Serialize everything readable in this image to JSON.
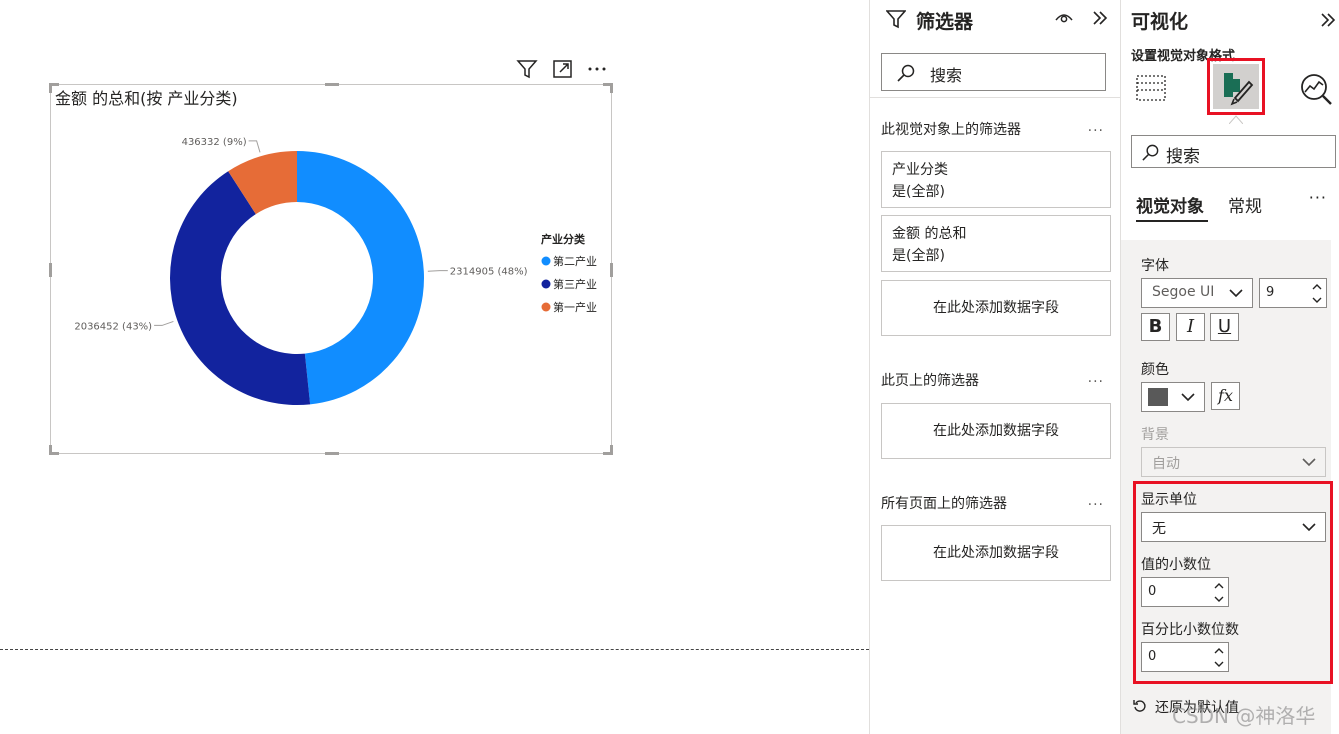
{
  "visual": {
    "title": "金额 的总和(按 产业分类)"
  },
  "chart_data": {
    "type": "pie",
    "subtype": "donut",
    "title": "金额 的总和(按 产业分类)",
    "legend_title": "产业分类",
    "legend_position": "right",
    "slices": [
      {
        "name": "第二产业",
        "value": 2314905,
        "percent": 48,
        "label": "2314905 (48%)",
        "color": "#118dff"
      },
      {
        "name": "第三产业",
        "value": 2036452,
        "percent": 43,
        "label": "2036452 (43%)",
        "color": "#12239e"
      },
      {
        "name": "第一产业",
        "value": 436332,
        "percent": 9,
        "label": "436332 (9%)",
        "color": "#e66c37"
      }
    ]
  },
  "filters": {
    "title": "筛选器",
    "search_label": "搜索",
    "visual_section": "此视觉对象上的筛选器",
    "visual_cards": [
      {
        "line1": "产业分类",
        "line2": "是(全部)"
      },
      {
        "line1": "金额 的总和",
        "line2": "是(全部)"
      }
    ],
    "add_field": "在此处添加数据字段",
    "page_section": "此页上的筛选器",
    "all_section": "所有页面上的筛选器",
    "more": "..."
  },
  "viz": {
    "title": "可视化",
    "subtitle": "设置视觉对象格式",
    "search_label": "搜索",
    "tabs": {
      "visual": "视觉对象",
      "general": "常规",
      "more": "···"
    },
    "font_label": "字体",
    "font_family": "Segoe UI",
    "font_size": "9",
    "bold": "B",
    "italic": "I",
    "underline": "U",
    "color_label": "颜色",
    "color_value": "#595959",
    "fx": "fx",
    "background_label": "背景",
    "background_value": "自动",
    "display_units_label": "显示单位",
    "display_units_value": "无",
    "value_decimals_label": "值的小数位",
    "value_decimals": "0",
    "percent_decimals_label": "百分比小数位数",
    "percent_decimals": "0",
    "reset_label": "还原为默认值"
  },
  "watermark": "CSDN @神洛华"
}
